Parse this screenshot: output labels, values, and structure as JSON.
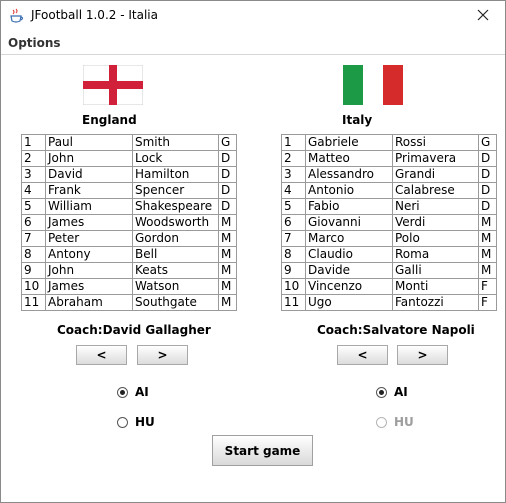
{
  "window": {
    "title": "JFootball 1.0.2 - Italia"
  },
  "menu": {
    "options_label": "Options"
  },
  "home": {
    "name": "England",
    "coach": "Coach:David Gallagher",
    "players": [
      {
        "num": "1",
        "first": "Paul",
        "last": "Smith",
        "pos": "G"
      },
      {
        "num": "2",
        "first": "John",
        "last": "Lock",
        "pos": "D"
      },
      {
        "num": "3",
        "first": "David",
        "last": "Hamilton",
        "pos": "D"
      },
      {
        "num": "4",
        "first": "Frank",
        "last": "Spencer",
        "pos": "D"
      },
      {
        "num": "5",
        "first": "William",
        "last": "Shakespeare",
        "pos": "D"
      },
      {
        "num": "6",
        "first": "James",
        "last": "Woodsworth",
        "pos": "M"
      },
      {
        "num": "7",
        "first": "Peter",
        "last": "Gordon",
        "pos": "M"
      },
      {
        "num": "8",
        "first": "Antony",
        "last": "Bell",
        "pos": "M"
      },
      {
        "num": "9",
        "first": "John",
        "last": "Keats",
        "pos": "M"
      },
      {
        "num": "10",
        "first": "James",
        "last": "Watson",
        "pos": "M"
      },
      {
        "num": "11",
        "first": "Abraham",
        "last": "Southgate",
        "pos": "M"
      }
    ],
    "prev_label": "<",
    "next_label": ">",
    "ai_label": "AI",
    "hu_label": "HU"
  },
  "away": {
    "name": "Italy",
    "coach": "Coach:Salvatore Napoli",
    "players": [
      {
        "num": "1",
        "first": "Gabriele",
        "last": "Rossi",
        "pos": "G"
      },
      {
        "num": "2",
        "first": "Matteo",
        "last": "Primavera",
        "pos": "D"
      },
      {
        "num": "3",
        "first": "Alessandro",
        "last": "Grandi",
        "pos": "D"
      },
      {
        "num": "4",
        "first": "Antonio",
        "last": "Calabrese",
        "pos": "D"
      },
      {
        "num": "5",
        "first": "Fabio",
        "last": "Neri",
        "pos": "D"
      },
      {
        "num": "6",
        "first": "Giovanni",
        "last": "Verdi",
        "pos": "M"
      },
      {
        "num": "7",
        "first": "Marco",
        "last": "Polo",
        "pos": "M"
      },
      {
        "num": "8",
        "first": "Claudio",
        "last": "Roma",
        "pos": "M"
      },
      {
        "num": "9",
        "first": "Davide",
        "last": "Galli",
        "pos": "M"
      },
      {
        "num": "10",
        "first": "Vincenzo",
        "last": "Monti",
        "pos": "F"
      },
      {
        "num": "11",
        "first": "Ugo",
        "last": "Fantozzi",
        "pos": "F"
      }
    ],
    "prev_label": "<",
    "next_label": ">",
    "ai_label": "AI",
    "hu_label": "HU"
  },
  "start_label": "Start game",
  "colors": {
    "england_red": "#d0203a",
    "italy_green": "#1c9a45",
    "italy_red": "#d62b2b"
  },
  "icons": {
    "app": "java-cup-icon",
    "close": "close-icon"
  }
}
